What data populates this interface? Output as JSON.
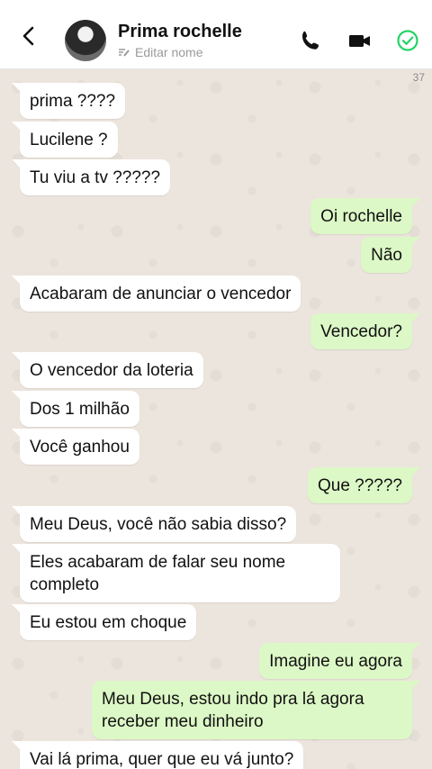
{
  "contact": {
    "name": "Prima rochelle",
    "edit_label": "Editar nome"
  },
  "message_count": "37",
  "messages": [
    {
      "dir": "in",
      "text": "prima ????"
    },
    {
      "dir": "in",
      "text": "Lucilene ?"
    },
    {
      "dir": "in",
      "text": "Tu viu a tv ?????"
    },
    {
      "dir": "out",
      "text": "Oi rochelle"
    },
    {
      "dir": "out",
      "text": "Não"
    },
    {
      "dir": "in",
      "text": "Acabaram de anunciar o vencedor"
    },
    {
      "dir": "out",
      "text": "Vencedor?"
    },
    {
      "dir": "in",
      "text": "O vencedor da loteria"
    },
    {
      "dir": "in",
      "text": "Dos 1 milhão"
    },
    {
      "dir": "in",
      "text": "Você ganhou"
    },
    {
      "dir": "out",
      "text": "Que ?????"
    },
    {
      "dir": "in",
      "text": "Meu Deus, você não sabia disso?"
    },
    {
      "dir": "in",
      "text": "Eles acabaram de falar seu nome completo"
    },
    {
      "dir": "in",
      "text": "Eu estou em choque"
    },
    {
      "dir": "out",
      "text": "Imagine eu agora"
    },
    {
      "dir": "out",
      "text": "Meu Deus, estou indo pra lá agora receber meu dinheiro"
    },
    {
      "dir": "in",
      "text": "Vai lá prima, quer que eu vá junto?"
    }
  ],
  "colors": {
    "incoming": "#ffffff",
    "outgoing": "#dcf8c6",
    "accent": "#25d366"
  },
  "icons": [
    "back-arrow-icon",
    "phone-icon",
    "video-camera-icon",
    "check-circle-icon",
    "pencil-lines-icon"
  ]
}
